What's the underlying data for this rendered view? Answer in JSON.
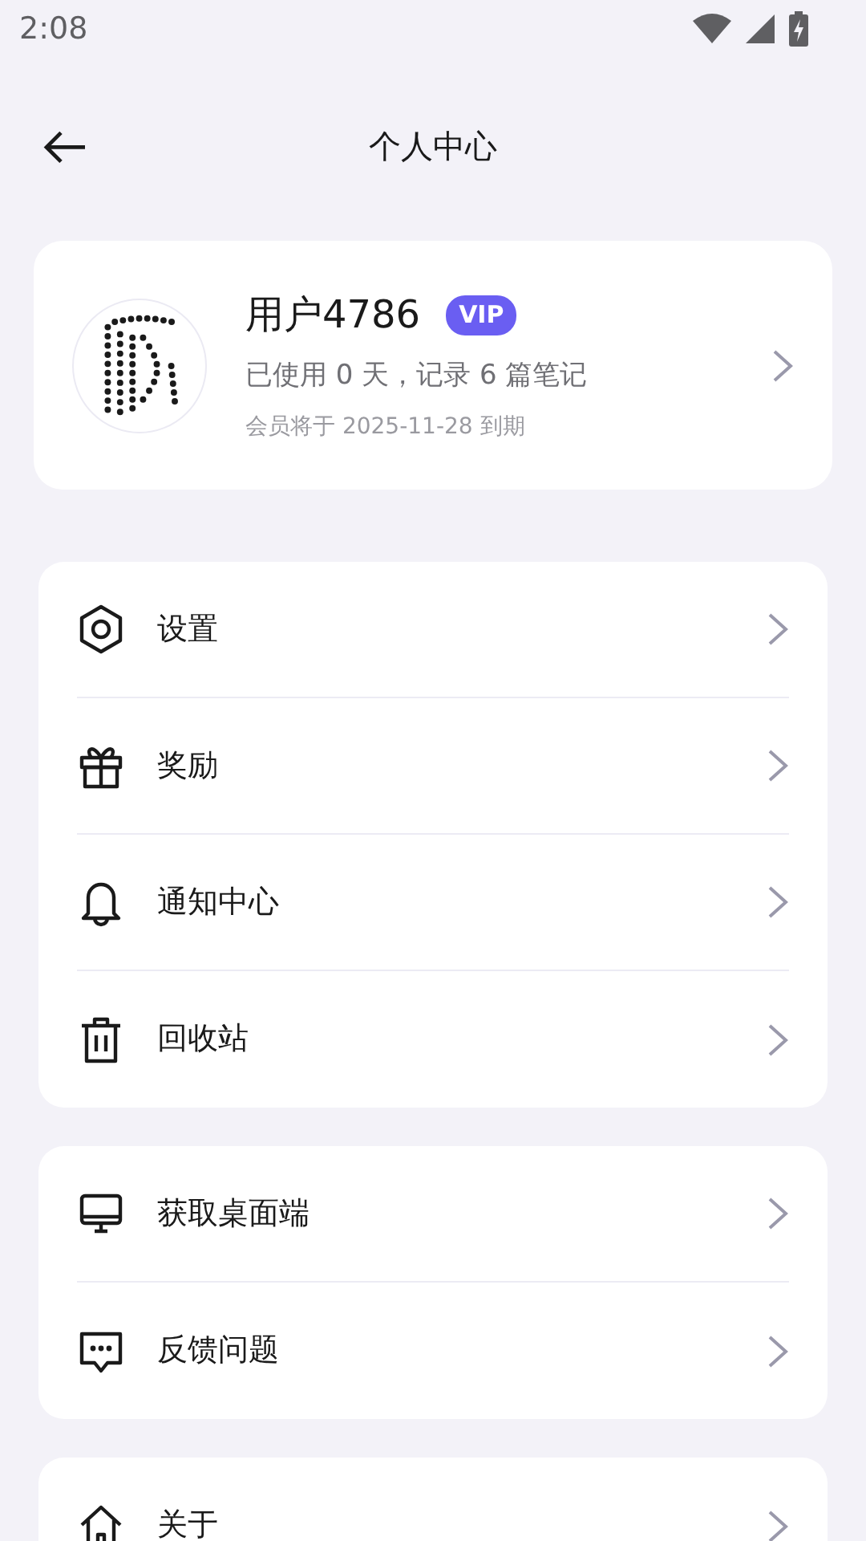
{
  "status_bar": {
    "time": "2:08"
  },
  "header": {
    "title": "个人中心"
  },
  "profile": {
    "name": "用户4786",
    "badge": "VIP",
    "usage": "已使用 0 天，记录 6 篇笔记",
    "expiry": "会员将于 2025-11-28 到期"
  },
  "groups": [
    {
      "items": [
        {
          "label": "设置"
        },
        {
          "label": "奖励"
        },
        {
          "label": "通知中心"
        },
        {
          "label": "回收站"
        }
      ]
    },
    {
      "items": [
        {
          "label": "获取桌面端"
        },
        {
          "label": "反馈问题"
        }
      ]
    },
    {
      "items": [
        {
          "label": "关于"
        }
      ]
    }
  ]
}
